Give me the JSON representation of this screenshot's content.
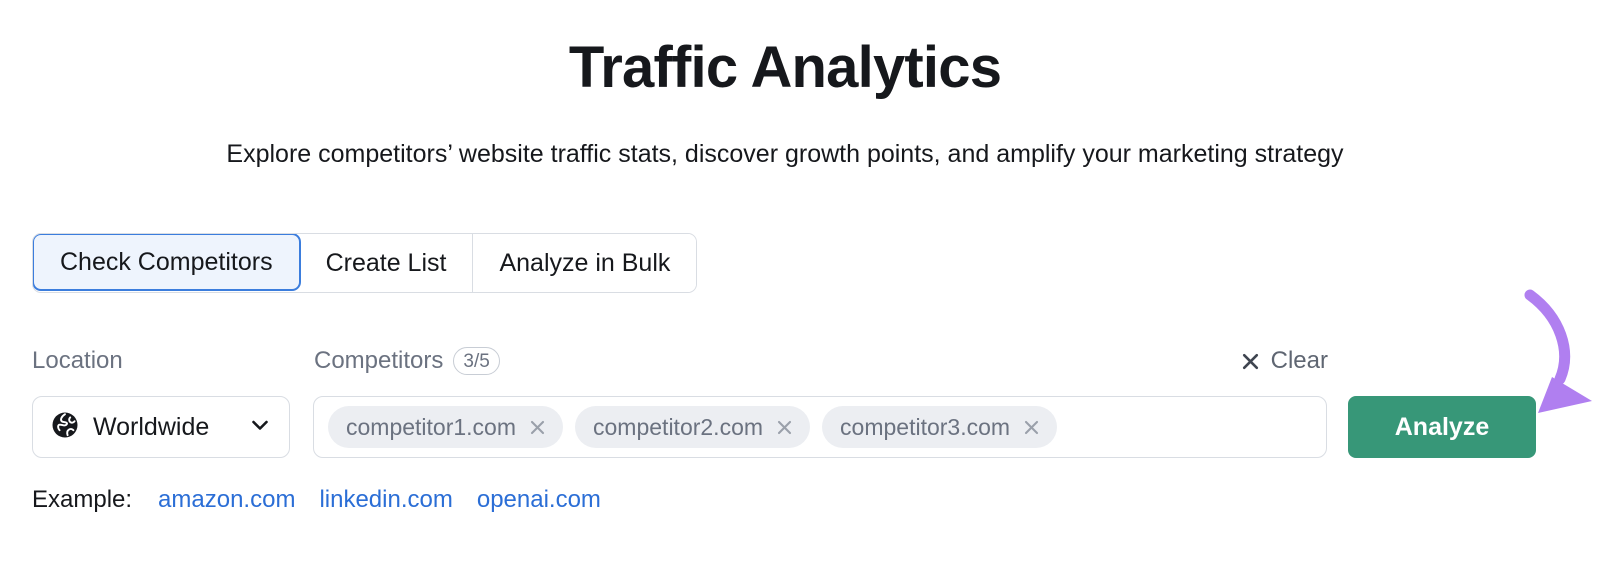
{
  "header": {
    "title": "Traffic Analytics",
    "subtitle": "Explore competitors’ website traffic stats, discover growth points, and amplify your marketing strategy"
  },
  "tabs": [
    {
      "label": "Check Competitors",
      "active": true
    },
    {
      "label": "Create List",
      "active": false
    },
    {
      "label": "Analyze in Bulk",
      "active": false
    }
  ],
  "form": {
    "location_label": "Location",
    "competitors_label": "Competitors",
    "competitors_count": "3/5",
    "clear_label": "Clear",
    "clear_icon": "close-icon",
    "location_value": "Worldwide",
    "location_icon": "globe-icon",
    "location_chevron": "chevron-down-icon",
    "competitors_placeholder": "",
    "competitors_input_value": "",
    "chips": [
      {
        "label": "competitor1.com",
        "remove_icon": "close-icon"
      },
      {
        "label": "competitor2.com",
        "remove_icon": "close-icon"
      },
      {
        "label": "competitor3.com",
        "remove_icon": "close-icon"
      }
    ],
    "analyze_label": "Analyze"
  },
  "example": {
    "label": "Example:",
    "links": [
      {
        "label": "amazon.com"
      },
      {
        "label": "linkedin.com"
      },
      {
        "label": "openai.com"
      }
    ]
  },
  "annotation": {
    "arrow_icon": "curved-arrow-icon",
    "arrow_color": "#b07ff0",
    "points_to": "Analyze"
  },
  "colors": {
    "accent_green": "#379778",
    "accent_blue": "#3b7ddd",
    "link_blue": "#2b6ed6",
    "active_tab_fill": "#eef4fd",
    "chip_fill": "#eceef2",
    "muted_text": "#6b7280",
    "border": "#d9dde3"
  }
}
